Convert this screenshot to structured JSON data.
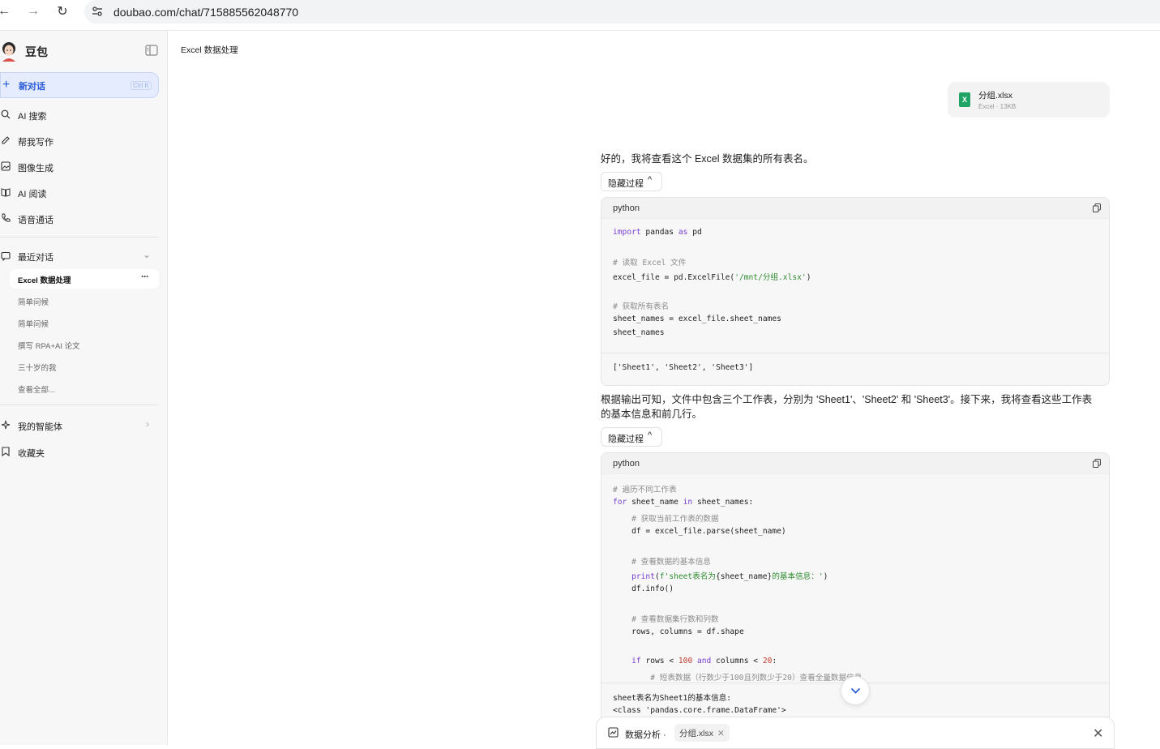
{
  "browser": {
    "url": "doubao.com/chat/715885562048770",
    "back_icon": "←",
    "forward_icon": "→",
    "reload_icon": "↻"
  },
  "sidebar": {
    "brand": "豆包",
    "new_chat": {
      "label": "新对话",
      "shortcut": "Ctrl K"
    },
    "menu": [
      {
        "icon": "ai-search-icon",
        "label": "AI 搜索"
      },
      {
        "icon": "pen-icon",
        "label": "帮我写作"
      },
      {
        "icon": "image-icon",
        "label": "图像生成"
      },
      {
        "icon": "book-icon",
        "label": "AI 阅读"
      },
      {
        "icon": "phone-icon",
        "label": "语音通话"
      }
    ],
    "recent_label": "最近对话",
    "conversations": [
      {
        "label": "Excel 数据处理",
        "active": true,
        "more": "···"
      },
      {
        "label": "简单问候"
      },
      {
        "label": "简单问候"
      },
      {
        "label": "撰写 RPA+AI 论文"
      },
      {
        "label": "三十岁的我"
      },
      {
        "label": "查看全部..."
      }
    ],
    "agents_label": "我的智能体",
    "favorites_label": "收藏夹"
  },
  "chat": {
    "title": "Excel 数据处理",
    "attachment": {
      "name": "分组.xlsx",
      "meta": "Excel · 13KB",
      "badge": "X"
    },
    "message1": "好的，我将查看这个 Excel 数据集的所有表名。",
    "hide_label": "隐藏过程",
    "code1": {
      "lang": "python",
      "output": "['Sheet1', 'Sheet2', 'Sheet3']"
    },
    "message2_line1": "根据输出可知，文件中包含三个工作表，分别为 'Sheet1'、'Sheet2' 和 'Sheet3'。接下来，我将查看这些工作表",
    "message2_line2": "的基本信息和前几行。",
    "code2": {
      "lang": "python",
      "output_line1": "sheet表名为Sheet1的基本信息:",
      "output_line2": "<class 'pandas.core.frame.DataFrame'>"
    }
  },
  "input": {
    "mode_label": "数据分析 ·",
    "file_chip": "分组.xlsx",
    "chip_close": "✕",
    "close": "✕"
  },
  "colors": {
    "accent": "#2a5bd7",
    "excel": "#21a366",
    "keyword": "#7a3fcf",
    "comment": "#8c8c8c",
    "string": "#2e8b2e",
    "number": "#c0392b"
  }
}
